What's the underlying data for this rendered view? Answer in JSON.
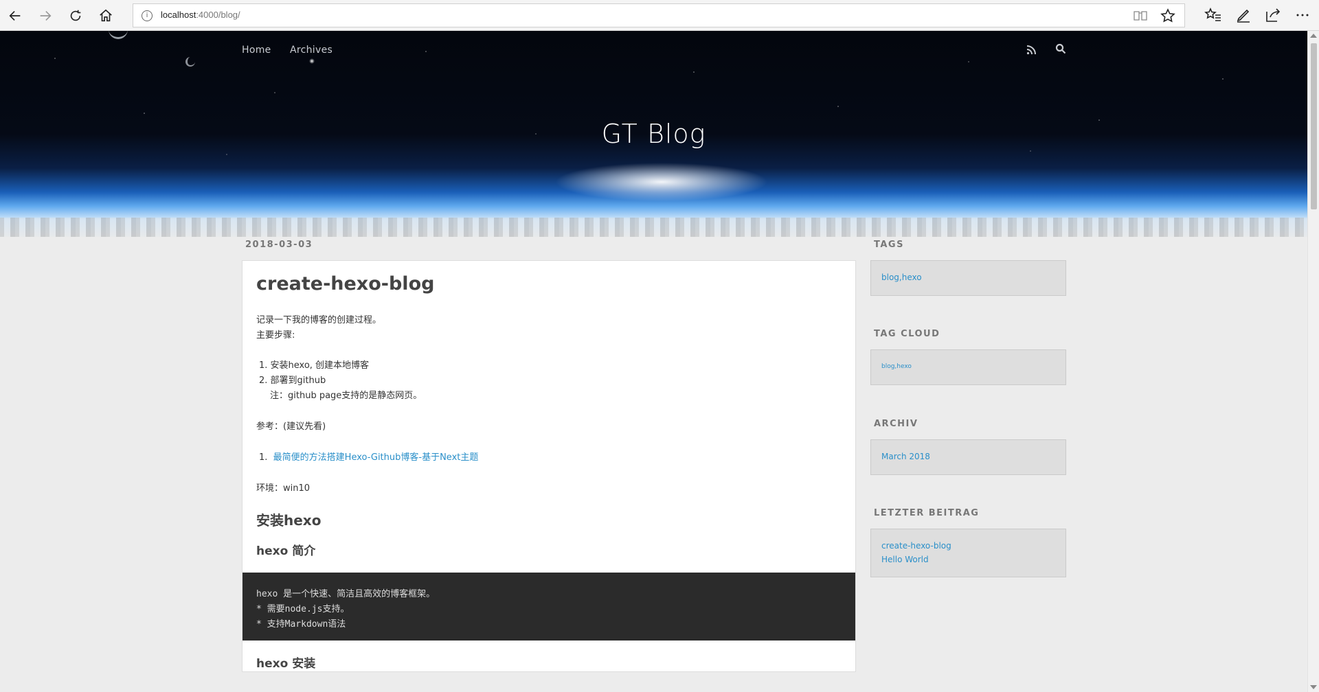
{
  "browser": {
    "url_host": "localhost",
    "url_rest": ":4000/blog/",
    "info_glyph": "i",
    "icons": [
      "back-icon",
      "forward-icon",
      "refresh-icon",
      "home-icon",
      "info-icon",
      "reading-view-icon",
      "favorite-star-icon",
      "favorites-hub-icon",
      "pen-icon",
      "share-icon",
      "more-icon"
    ]
  },
  "header": {
    "nav": [
      "Home",
      "Archives"
    ],
    "title": "GT Blog",
    "icons": [
      "rss-icon",
      "search-icon"
    ]
  },
  "post": {
    "date": "2018-03-03",
    "title": "create-hexo-blog",
    "intro_line1": "记录一下我的博客的创建过程。",
    "intro_line2": "主要步骤:",
    "steps": [
      "1.  安装hexo, 创建本地博客",
      "2.  部署到github"
    ],
    "step_note": "注：github page支持的是静态网页。",
    "ref_label": "参考：(建议先看)",
    "ref_num": "1.",
    "ref_link": "最简便的方法搭建Hexo-Github博客-基于Next主题",
    "env": "环境：win10",
    "h2": "安装hexo",
    "h3_intro": "hexo 简介",
    "code_lines": [
      "hexo 是一个快速、简洁且高效的博客框架。",
      "* 需要node.js支持。",
      "* 支持Markdown语法"
    ],
    "h3_install": "hexo 安装"
  },
  "sidebar": {
    "tags_title": "TAGS",
    "tags_item": "blog,hexo",
    "tagcloud_title": "TAG CLOUD",
    "tagcloud_item": "blog,hexo",
    "archive_title": "ARCHIV",
    "archive_item": "March 2018",
    "recent_title": "LETZTER BEITRAG",
    "recent_items": [
      "create-hexo-blog",
      "Hello World"
    ]
  }
}
